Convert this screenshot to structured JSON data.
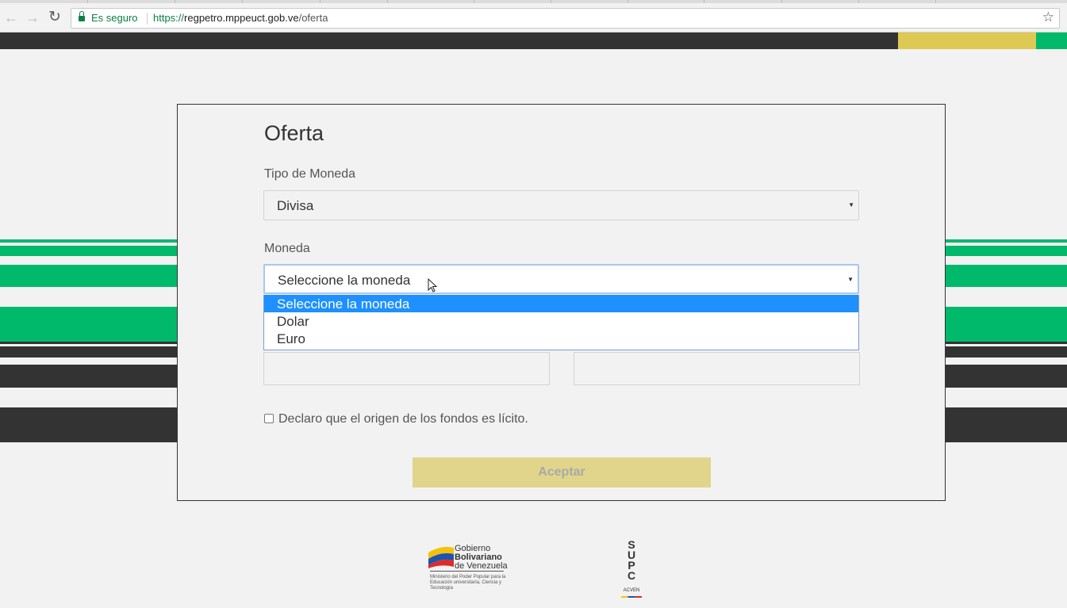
{
  "browser": {
    "secure_label": "Es seguro",
    "url_scheme": "https://",
    "url_host": "regpetro.mppeuct.gob.ve",
    "url_path": "/oferta"
  },
  "colors": {
    "brand_dark": "#333333",
    "brand_yellow": "#dec955",
    "brand_green": "#00b96b",
    "option_highlight": "#1e90ff",
    "button_disabled": "#e1d58b"
  },
  "form": {
    "title": "Oferta",
    "tipo_moneda_label": "Tipo de Moneda",
    "tipo_moneda_value": "Divisa",
    "moneda_label": "Moneda",
    "moneda_value": "Seleccione la moneda",
    "moneda_options": [
      "Seleccione la moneda",
      "Dolar",
      "Euro"
    ],
    "moneda_selected_index": 0,
    "checkbox_label": "Declaro que el origen de los fondos es lícito.",
    "checkbox_checked": false,
    "submit_label": "Aceptar",
    "submit_disabled": true
  },
  "footer": {
    "gob_line1": "Gobierno",
    "gob_line2": "Bolivariano",
    "gob_line3": "de Venezuela",
    "gob_sub": "Ministerio del Poder Popular para la Educación universitaria, Ciencia y Tecnología",
    "supc_letters": [
      "S",
      "U",
      "P",
      "C"
    ],
    "supc_sub": "ACVEN"
  },
  "icons": {
    "back": "arrow-left-icon",
    "forward": "arrow-right-icon",
    "reload": "reload-icon",
    "lock": "lock-icon",
    "bookmark": "star-icon",
    "caret": "caret-down-icon",
    "cursor": "mouse-pointer-icon"
  }
}
